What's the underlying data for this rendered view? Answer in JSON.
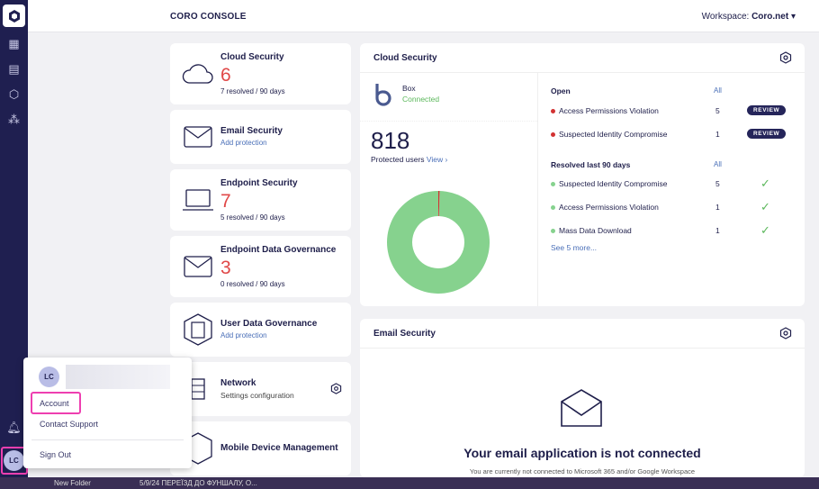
{
  "app": {
    "title": "CORO CONSOLE",
    "workspace_label": "Workspace:",
    "workspace": "Coro.net"
  },
  "sidebar": {
    "items": [
      {
        "icon": "dashboard-icon"
      },
      {
        "icon": "list-icon"
      },
      {
        "icon": "settings-hex-icon"
      },
      {
        "icon": "network-nodes-icon"
      }
    ],
    "bell_icon": "bell-icon",
    "avatar": "LC"
  },
  "cards": [
    {
      "name": "Cloud Security",
      "count": "6",
      "sub": "7 resolved / 90 days"
    },
    {
      "name": "Email Security",
      "link": "Add protection"
    },
    {
      "name": "Endpoint Security",
      "count": "7",
      "sub": "5 resolved / 90 days"
    },
    {
      "name": "Endpoint Data Governance",
      "count": "3",
      "sub": "0 resolved / 90 days"
    },
    {
      "name": "User Data Governance",
      "link": "Add protection"
    },
    {
      "name": "Network",
      "sub": "Settings configuration"
    },
    {
      "name": "Mobile Device Management"
    }
  ],
  "cloud_panel": {
    "title": "Cloud Security",
    "app": "Box",
    "status": "Connected",
    "protected": "818",
    "protected_label": "Protected users",
    "view": "View ›",
    "open_label": "Open",
    "all": "All",
    "resolved_label": "Resolved last 90 days",
    "open": [
      {
        "label": "Access Permissions Violation",
        "n": "5",
        "action": "REVIEW"
      },
      {
        "label": "Suspected Identity Compromise",
        "n": "1",
        "action": "REVIEW"
      }
    ],
    "resolved": [
      {
        "label": "Suspected Identity Compromise",
        "n": "5"
      },
      {
        "label": "Access Permissions Violation",
        "n": "1"
      },
      {
        "label": "Mass Data Download",
        "n": "1"
      }
    ],
    "see_more": "See 5 more...",
    "donut": {
      "protected_fraction": 0.99,
      "issue_fraction": 0.01,
      "colors": {
        "ok": "#86d28e",
        "issue": "#d23232"
      }
    }
  },
  "email_panel": {
    "title": "Email Security",
    "heading": "Your email application is not connected",
    "text": "You are currently not connected to Microsoft 365 and/or Google Workspace"
  },
  "menu": {
    "avatar": "LC",
    "account": "Account",
    "support": "Contact Support",
    "signout": "Sign Out"
  },
  "taskbar": {
    "folder": "New Folder",
    "item": "5/9/24  ПЕРЕЇЗД ДО ФУНШАЛУ, О..."
  },
  "colors": {
    "sidebar": "#1f1f50",
    "alert": "#e04848",
    "link": "#4a6fb8",
    "highlight": "#ee3fb0"
  }
}
